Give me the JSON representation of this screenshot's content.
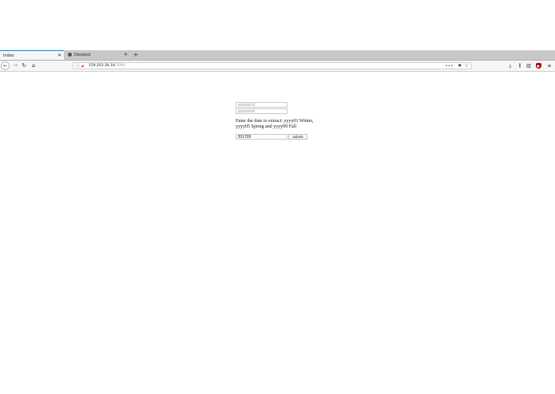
{
  "browser": {
    "tabs": [
      {
        "label": "index",
        "active": true
      },
      {
        "label": "Devpost",
        "active": false
      }
    ],
    "new_tab_label": "+",
    "url_host": "159.203.34.18",
    "url_port": ":5000"
  },
  "form": {
    "student_placeholder": "student id",
    "password_placeholder": "password",
    "prompt": "Enter the date to extract: yyyy01 Winter, yyyy05 Spring and yyyy09 Fall",
    "date_value": "201709",
    "submit_label": "submit"
  },
  "colors": {
    "tab_accent": "#0a84ff",
    "insecure_lock": "#cc0000"
  },
  "icons": [
    "back-icon",
    "forward-icon",
    "reload-icon",
    "home-icon",
    "info-icon",
    "insecure-lock-icon",
    "more-icon",
    "pocket-icon",
    "bookmark-star-icon",
    "download-icon",
    "library-icon",
    "sidebar-icon",
    "ublock-icon",
    "menu-icon",
    "close-icon"
  ]
}
